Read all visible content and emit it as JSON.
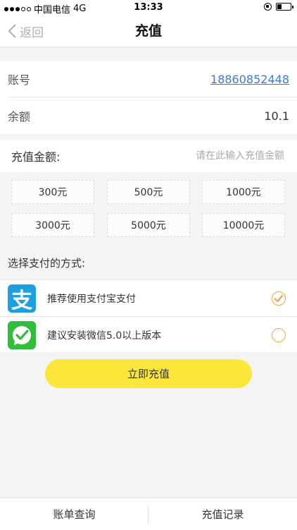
{
  "status_bar": {
    "carrier": "中国电信",
    "network": "4G",
    "time": "13:33"
  },
  "nav": {
    "back_label": "返回",
    "title": "充值"
  },
  "account": {
    "account_label": "账号",
    "account_value": "18860852448",
    "balance_label": "余额",
    "balance_value": "10.1"
  },
  "amount": {
    "label": "充值金额:",
    "placeholder": "请在此输入充值金额"
  },
  "presets": [
    "300元",
    "500元",
    "1000元",
    "3000元",
    "5000元",
    "10000元"
  ],
  "payment": {
    "title": "选择支付的方式:",
    "options": [
      {
        "icon": "alipay-icon",
        "text": "推荐使用支付宝支付",
        "selected": true
      },
      {
        "icon": "wechat-icon",
        "text": "建议安装微信5.0以上版本",
        "selected": false
      }
    ]
  },
  "submit_label": "立即充值",
  "tabs": [
    "账单查询",
    "充值记录"
  ],
  "colors": {
    "accent_yellow": "#fbe73c",
    "radio_orange": "#f0a33a",
    "link_blue": "#3b78d8",
    "alipay_blue": "#1e9fe0",
    "wechat_green": "#2fbd3a"
  }
}
